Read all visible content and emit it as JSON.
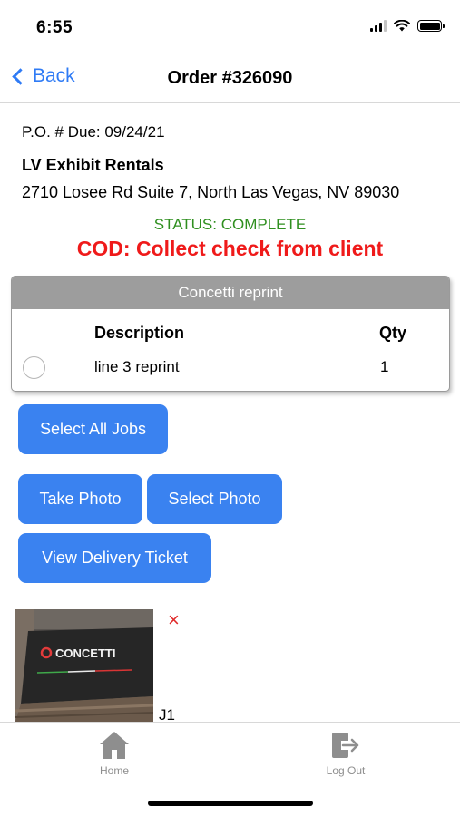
{
  "status_bar": {
    "time": "6:55"
  },
  "nav": {
    "back_label": "Back",
    "title": "Order #326090"
  },
  "order": {
    "po_due": "P.O. # Due: 09/24/21",
    "client_name": "LV Exhibit Rentals",
    "client_address": "2710 Losee Rd Suite 7, North Las Vegas, NV 89030",
    "status": "STATUS: COMPLETE",
    "cod": "COD: Collect check from client"
  },
  "job": {
    "title": "Concetti reprint",
    "columns": {
      "description": "Description",
      "qty": "Qty"
    },
    "rows": [
      {
        "description": "line 3 reprint",
        "qty": "1"
      }
    ]
  },
  "buttons": {
    "select_all": "Select All Jobs",
    "take_photo": "Take Photo",
    "select_photo": "Select Photo",
    "view_ticket": "View Delivery Ticket"
  },
  "photo": {
    "label": "J1",
    "remove_glyph": "×",
    "logo_text": "CONCETTI"
  },
  "tabs": [
    {
      "label": "Home",
      "icon": "home-icon"
    },
    {
      "label": "Log Out",
      "icon": "logout-icon"
    }
  ],
  "colors": {
    "accent": "#3a82f0",
    "status_green": "#2f8f1f",
    "cod_red": "#ef1a1a",
    "card_header": "#9d9d9d"
  }
}
